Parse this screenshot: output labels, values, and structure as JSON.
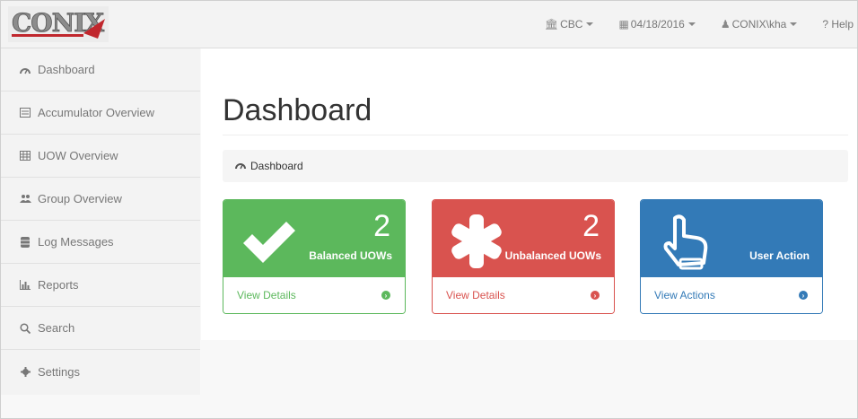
{
  "brand": {
    "logo_text": "CONIX"
  },
  "navbar": {
    "bank": "CBC",
    "date": "04/18/2016",
    "user": "CONIX\\kha",
    "help": "? Help"
  },
  "sidebar": {
    "items": [
      {
        "label": "Dashboard",
        "icon": "dashboard-icon"
      },
      {
        "label": "Accumulator Overview",
        "icon": "list-icon"
      },
      {
        "label": "UOW Overview",
        "icon": "table-icon"
      },
      {
        "label": "Group Overview",
        "icon": "users-icon"
      },
      {
        "label": "Log Messages",
        "icon": "database-icon"
      },
      {
        "label": "Reports",
        "icon": "bar-chart-icon"
      },
      {
        "label": "Search",
        "icon": "search-icon"
      },
      {
        "label": "Settings",
        "icon": "gear-icon"
      }
    ]
  },
  "main": {
    "title": "Dashboard",
    "breadcrumb": "Dashboard",
    "panels": [
      {
        "count": "2",
        "label": "Balanced UOWs",
        "link": "View Details",
        "color": "#5cb85c",
        "icon": "check-icon"
      },
      {
        "count": "2",
        "label": "Unbalanced UOWs",
        "link": "View Details",
        "color": "#d9534f",
        "icon": "asterisk-icon"
      },
      {
        "count": "",
        "label": "User Action",
        "link": "View Actions",
        "color": "#337ab7",
        "icon": "hand-pointer-icon"
      }
    ]
  }
}
